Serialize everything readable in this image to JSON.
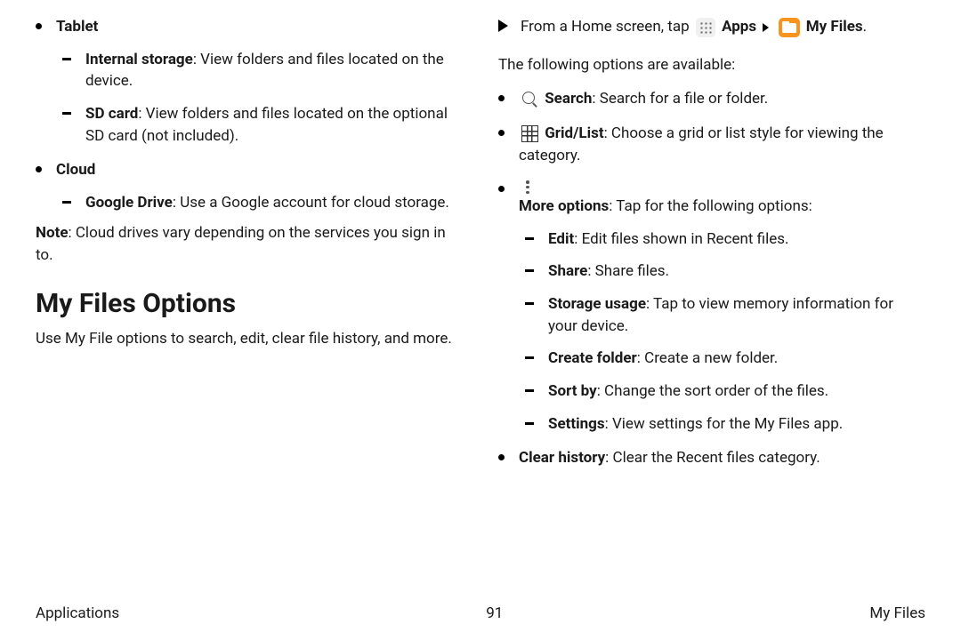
{
  "left": {
    "tablet_label": "Tablet",
    "internal_storage_bold": "Internal storage",
    "internal_storage_text": ": View folders and files located on the device.",
    "sd_card_bold": "SD card",
    "sd_card_text": ": View folders and files located on the optional SD card (not included).",
    "cloud_label": "Cloud",
    "gdrive_bold": "Google Drive",
    "gdrive_text": ": Use a Google account for cloud storage.",
    "note_bold": "Note",
    "note_text": ": Cloud drives vary depending on the services you sign in to.",
    "heading": "My Files Options",
    "intro": "Use My File options to search, edit, clear file history, and more."
  },
  "right": {
    "step_pre": "From a Home screen, tap ",
    "apps_label": "Apps",
    "myfiles_label": "My Files",
    "avail_text": "The following options are available:",
    "search_bold": "Search",
    "search_text": ": Search for a file or folder.",
    "gridlist_bold": "Grid/List",
    "gridlist_text": ": Choose a grid or list style for viewing the category.",
    "more_bold": "More options",
    "more_text": ": Tap for the following options:",
    "edit_bold": "Edit",
    "edit_text": ": Edit files shown in Recent files.",
    "share_bold": "Share",
    "share_text": ": Share files.",
    "storage_bold": "Storage usage",
    "storage_text": ": Tap to view memory information for your device.",
    "create_bold": "Create folder",
    "create_text": ": Create a new folder.",
    "sort_bold": "Sort by",
    "sort_text": ": Change the sort order of the files.",
    "settings_bold": "Settings",
    "settings_text": ": View settings for the My Files app.",
    "clear_bold": "Clear history",
    "clear_text": ": Clear the Recent files category."
  },
  "footer": {
    "left": "Applications",
    "center": "91",
    "right": "My Files"
  }
}
